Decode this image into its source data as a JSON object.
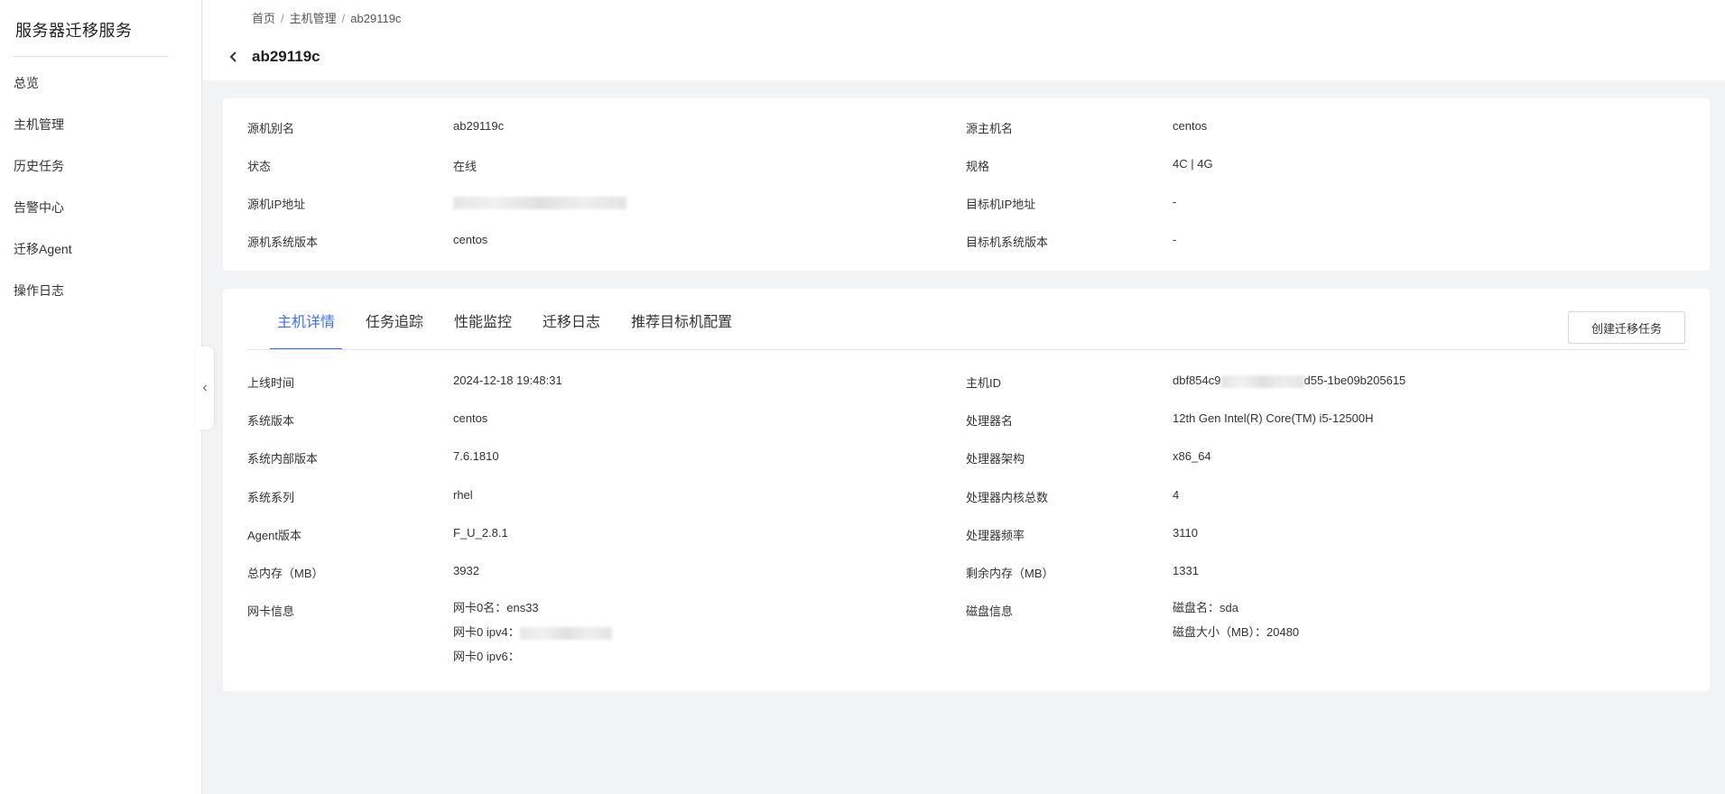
{
  "sidebar": {
    "title": "服务器迁移服务",
    "items": [
      {
        "label": "总览"
      },
      {
        "label": "主机管理"
      },
      {
        "label": "历史任务"
      },
      {
        "label": "告警中心"
      },
      {
        "label": "迁移Agent"
      },
      {
        "label": "操作日志"
      }
    ]
  },
  "header": {
    "breadcrumb": [
      "首页",
      "主机管理",
      "ab29119c"
    ],
    "breadcrumb_sep": "/",
    "title": "ab29119c",
    "back_icon": "chevron-left-icon"
  },
  "basic_info": {
    "source_alias": {
      "label": "源机别名",
      "value": "ab29119c"
    },
    "source_hostname": {
      "label": "源主机名",
      "value": "centos"
    },
    "status": {
      "label": "状态",
      "value": "在线"
    },
    "spec": {
      "label": "规格",
      "value": "4C | 4G"
    },
    "source_ip": {
      "label": "源机IP地址",
      "value": ""
    },
    "target_ip": {
      "label": "目标机IP地址",
      "value": "-"
    },
    "source_os": {
      "label": "源机系统版本",
      "value": "centos"
    },
    "target_os": {
      "label": "目标机系统版本",
      "value": "-"
    }
  },
  "tabs": [
    {
      "label": "主机详情",
      "active": true
    },
    {
      "label": "任务追踪"
    },
    {
      "label": "性能监控"
    },
    {
      "label": "迁移日志"
    },
    {
      "label": "推荐目标机配置"
    }
  ],
  "create_task_button": "创建迁移任务",
  "details": {
    "online_time": {
      "label": "上线时间",
      "value": "2024-12-18 19:48:31"
    },
    "host_id": {
      "label": "主机ID",
      "value_prefix": "dbf854c9",
      "value_suffix": "d55-1be09b205615"
    },
    "os_version": {
      "label": "系统版本",
      "value": "centos"
    },
    "cpu_name": {
      "label": "处理器名",
      "value": "12th Gen Intel(R) Core(TM) i5-12500H"
    },
    "os_internal_version": {
      "label": "系统内部版本",
      "value": "7.6.1810"
    },
    "cpu_arch": {
      "label": "处理器架构",
      "value": "x86_64"
    },
    "os_family": {
      "label": "系统系列",
      "value": "rhel"
    },
    "cpu_cores": {
      "label": "处理器内核总数",
      "value": "4"
    },
    "agent_version": {
      "label": "Agent版本",
      "value": "F_U_2.8.1"
    },
    "cpu_freq": {
      "label": "处理器频率",
      "value": "3110"
    },
    "total_mem": {
      "label": "总内存（MB）",
      "value": "3932"
    },
    "free_mem": {
      "label": "剩余内存（MB）",
      "value": "1331"
    },
    "nic_info": {
      "label": "网卡信息",
      "lines": [
        "网卡0名：ens33",
        "网卡0 ipv4：",
        "网卡0 ipv6："
      ]
    },
    "disk_info": {
      "label": "磁盘信息",
      "lines": [
        "磁盘名：sda",
        "磁盘大小（MB）：20480"
      ]
    }
  },
  "colors": {
    "accent": "#3a6ff7",
    "page_bg": "#f2f3f5",
    "card_bg": "#ffffff"
  }
}
